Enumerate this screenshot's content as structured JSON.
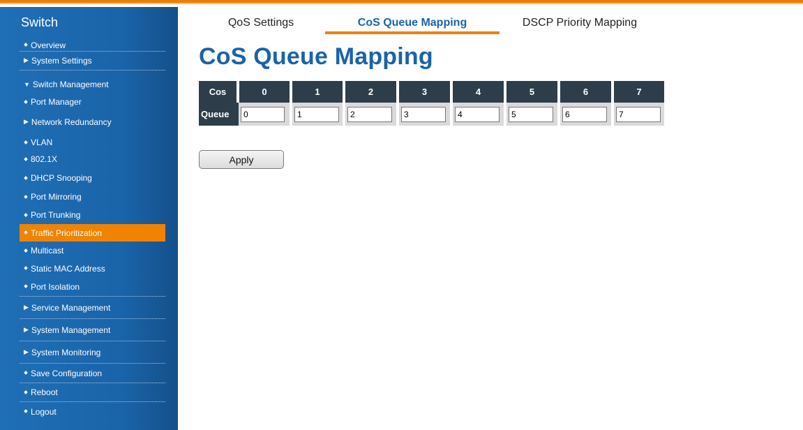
{
  "sidebar": {
    "brand": "Switch",
    "items": [
      {
        "label": "Overview",
        "marker": "bullet"
      },
      {
        "label": "System Settings",
        "marker": "triangle-right"
      },
      {
        "label": "Switch Management",
        "marker": "triangle-down"
      },
      {
        "label": "Port Manager",
        "marker": "bullet"
      },
      {
        "label": "Network Redundancy",
        "marker": "triangle-right"
      },
      {
        "label": "VLAN",
        "marker": "bullet"
      },
      {
        "label": "802.1X",
        "marker": "bullet"
      },
      {
        "label": "DHCP Snooping",
        "marker": "bullet"
      },
      {
        "label": "Port Mirroring",
        "marker": "bullet"
      },
      {
        "label": "Port Trunking",
        "marker": "bullet"
      },
      {
        "label": "Traffic Prioritization",
        "marker": "bullet",
        "active": true
      },
      {
        "label": "Multicast",
        "marker": "bullet"
      },
      {
        "label": "Static MAC Address",
        "marker": "bullet"
      },
      {
        "label": "Port Isolation",
        "marker": "bullet"
      },
      {
        "label": "Service Management",
        "marker": "triangle-right"
      },
      {
        "label": "System Management",
        "marker": "triangle-right"
      },
      {
        "label": "System Monitoring",
        "marker": "triangle-right"
      },
      {
        "label": "Save Configuration",
        "marker": "bullet"
      },
      {
        "label": "Reboot",
        "marker": "bullet"
      },
      {
        "label": "Logout",
        "marker": "bullet"
      }
    ]
  },
  "tabs": [
    {
      "label": "QoS Settings"
    },
    {
      "label": "CoS Queue Mapping",
      "selected": true
    },
    {
      "label": "DSCP Priority Mapping"
    }
  ],
  "page_title": "CoS Queue Mapping",
  "table": {
    "row_header_cos": "Cos",
    "row_header_queue": "Queue",
    "cos_values": [
      "0",
      "1",
      "2",
      "3",
      "4",
      "5",
      "6",
      "7"
    ],
    "queue_values": [
      "0",
      "1",
      "2",
      "3",
      "4",
      "5",
      "6",
      "7"
    ]
  },
  "apply_label": "Apply",
  "colors": {
    "accent_orange": "#f08300",
    "sidebar_blue": "#1a63a8",
    "table_header": "#2d3e4a",
    "title_blue": "#1a63a8"
  }
}
